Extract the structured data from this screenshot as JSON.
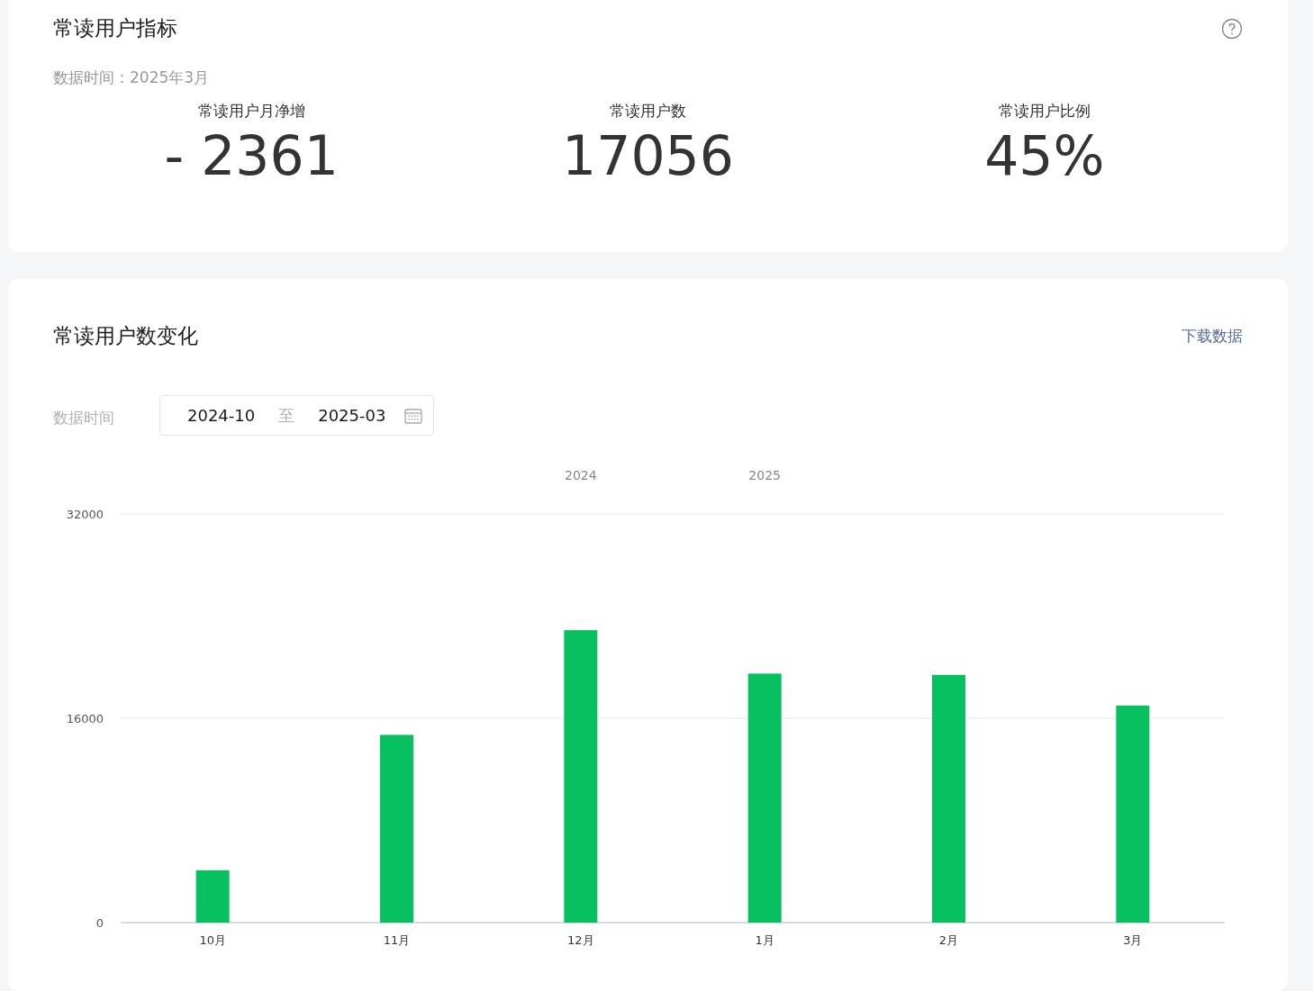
{
  "summary": {
    "title": "常读用户指标",
    "data_time": "数据时间：2025年3月",
    "metrics": [
      {
        "label": "常读用户月净增",
        "value": "- 2361"
      },
      {
        "label": "常读用户数",
        "value": "17056"
      },
      {
        "label": "常读用户比例",
        "value": "45%"
      }
    ]
  },
  "trend": {
    "title": "常读用户数变化",
    "download_link": "下载数据",
    "filter_label": "数据时间",
    "date_range": {
      "start": "2024-10",
      "separator": "至",
      "end": "2025-03"
    },
    "chart_data": {
      "type": "bar",
      "categories": [
        "10月",
        "11月",
        "12月",
        "1月",
        "2月",
        "3月"
      ],
      "series": [
        {
          "color": "#07c160",
          "values": [
            4100,
            14700,
            22900,
            19500,
            19400,
            17000
          ]
        }
      ],
      "ylim": [
        0,
        32000
      ],
      "yticks": [
        0,
        16000,
        32000
      ],
      "annotations": [
        "2024",
        "2025"
      ]
    }
  }
}
